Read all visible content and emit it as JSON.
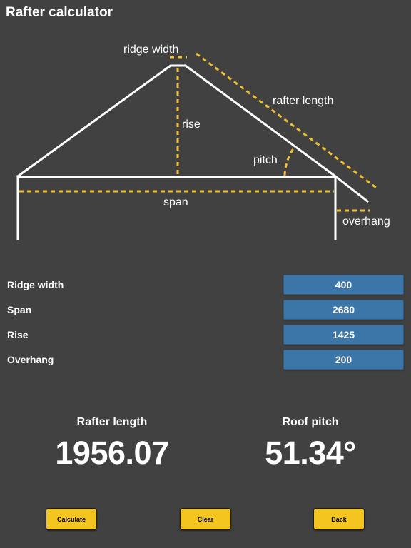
{
  "app": {
    "title": "Rafter calculator"
  },
  "diagram": {
    "labels": {
      "ridge_width": "ridge width",
      "rafter_length": "rafter length",
      "rise": "rise",
      "pitch": "pitch",
      "span": "span",
      "overhang": "overhang"
    },
    "colors": {
      "line": "#ffffff",
      "dimension": "#f0c030"
    }
  },
  "inputs": [
    {
      "label": "Ridge width",
      "value": "400"
    },
    {
      "label": "Span",
      "value": "2680"
    },
    {
      "label": "Rise",
      "value": "1425"
    },
    {
      "label": "Overhang",
      "value": "200"
    }
  ],
  "results": {
    "rafter_length": {
      "label": "Rafter length",
      "value": "1956.07"
    },
    "roof_pitch": {
      "label": "Roof pitch",
      "value": "51.34°"
    }
  },
  "buttons": {
    "calculate": "Calculate",
    "clear": "Clear",
    "back": "Back"
  },
  "colors": {
    "background": "#414141",
    "input_fill": "#3c76a9",
    "button_fill": "#f5c51f"
  }
}
